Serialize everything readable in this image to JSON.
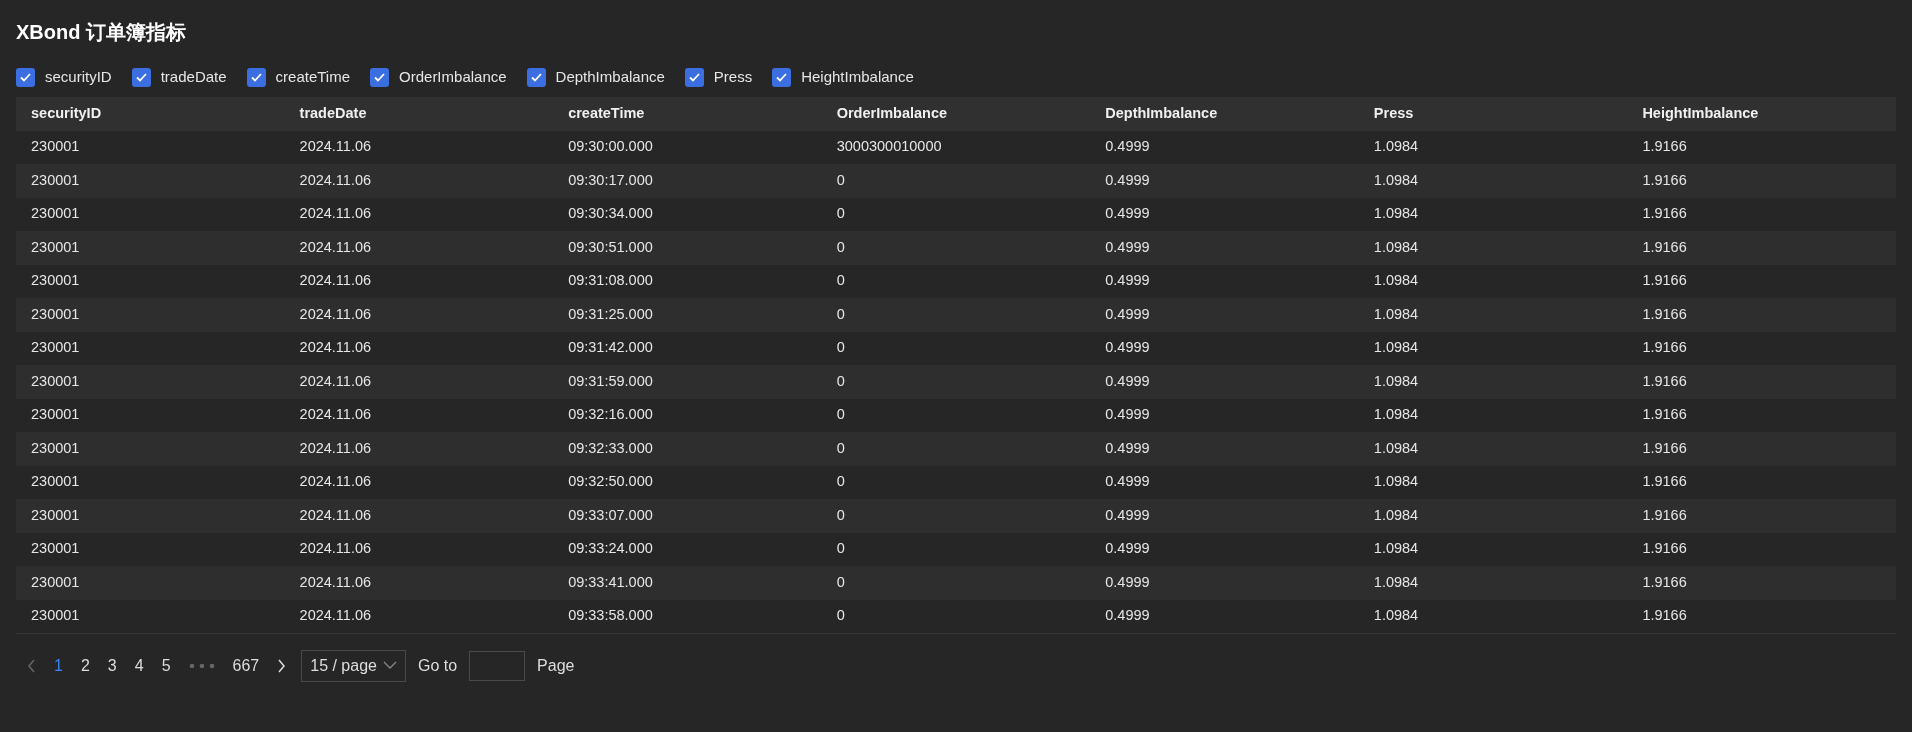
{
  "title": "XBond 订单簿指标",
  "column_toggles": [
    {
      "label": "securityID",
      "checked": true
    },
    {
      "label": "tradeDate",
      "checked": true
    },
    {
      "label": "createTime",
      "checked": true
    },
    {
      "label": "OrderImbalance",
      "checked": true
    },
    {
      "label": "DepthImbalance",
      "checked": true
    },
    {
      "label": "Press",
      "checked": true
    },
    {
      "label": "HeightImbalance",
      "checked": true
    }
  ],
  "table": {
    "columns": [
      "securityID",
      "tradeDate",
      "createTime",
      "OrderImbalance",
      "DepthImbalance",
      "Press",
      "HeightImbalance"
    ],
    "rows": [
      [
        "230001",
        "2024.11.06",
        "09:30:00.000",
        "3000300010000",
        "0.4999",
        "1.0984",
        "1.9166"
      ],
      [
        "230001",
        "2024.11.06",
        "09:30:17.000",
        "0",
        "0.4999",
        "1.0984",
        "1.9166"
      ],
      [
        "230001",
        "2024.11.06",
        "09:30:34.000",
        "0",
        "0.4999",
        "1.0984",
        "1.9166"
      ],
      [
        "230001",
        "2024.11.06",
        "09:30:51.000",
        "0",
        "0.4999",
        "1.0984",
        "1.9166"
      ],
      [
        "230001",
        "2024.11.06",
        "09:31:08.000",
        "0",
        "0.4999",
        "1.0984",
        "1.9166"
      ],
      [
        "230001",
        "2024.11.06",
        "09:31:25.000",
        "0",
        "0.4999",
        "1.0984",
        "1.9166"
      ],
      [
        "230001",
        "2024.11.06",
        "09:31:42.000",
        "0",
        "0.4999",
        "1.0984",
        "1.9166"
      ],
      [
        "230001",
        "2024.11.06",
        "09:31:59.000",
        "0",
        "0.4999",
        "1.0984",
        "1.9166"
      ],
      [
        "230001",
        "2024.11.06",
        "09:32:16.000",
        "0",
        "0.4999",
        "1.0984",
        "1.9166"
      ],
      [
        "230001",
        "2024.11.06",
        "09:32:33.000",
        "0",
        "0.4999",
        "1.0984",
        "1.9166"
      ],
      [
        "230001",
        "2024.11.06",
        "09:32:50.000",
        "0",
        "0.4999",
        "1.0984",
        "1.9166"
      ],
      [
        "230001",
        "2024.11.06",
        "09:33:07.000",
        "0",
        "0.4999",
        "1.0984",
        "1.9166"
      ],
      [
        "230001",
        "2024.11.06",
        "09:33:24.000",
        "0",
        "0.4999",
        "1.0984",
        "1.9166"
      ],
      [
        "230001",
        "2024.11.06",
        "09:33:41.000",
        "0",
        "0.4999",
        "1.0984",
        "1.9166"
      ],
      [
        "230001",
        "2024.11.06",
        "09:33:58.000",
        "0",
        "0.4999",
        "1.0984",
        "1.9166"
      ]
    ]
  },
  "pagination": {
    "prev_disabled": true,
    "pages": [
      {
        "kind": "page",
        "label": "1",
        "selected": true
      },
      {
        "kind": "page",
        "label": "2",
        "selected": false
      },
      {
        "kind": "page",
        "label": "3",
        "selected": false
      },
      {
        "kind": "page",
        "label": "4",
        "selected": false
      },
      {
        "kind": "page",
        "label": "5",
        "selected": false
      },
      {
        "kind": "ellipsis",
        "selected": false
      },
      {
        "kind": "page",
        "label": "667",
        "selected": false
      }
    ],
    "page_size": "15 / page",
    "goto_label": "Go to",
    "page_label": "Page"
  }
}
